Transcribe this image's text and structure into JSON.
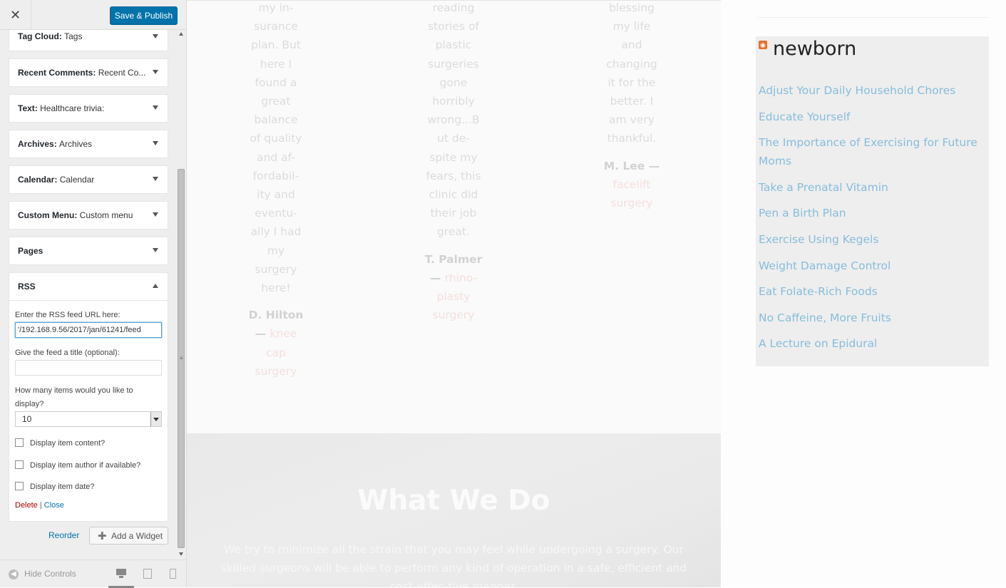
{
  "header": {
    "close_glyph": "✕",
    "save_publish": "Save & Publish"
  },
  "widgets": [
    {
      "type": "Tag Cloud:",
      "name": "Tags"
    },
    {
      "type": "Recent Comments:",
      "name": "Recent Co..."
    },
    {
      "type": "Text:",
      "name": "Healthcare trivia:"
    },
    {
      "type": "Archives:",
      "name": "Archives"
    },
    {
      "type": "Calendar:",
      "name": "Calendar"
    },
    {
      "type": "Custom Menu:",
      "name": "Custom menu"
    },
    {
      "type": "Pages",
      "name": ""
    }
  ],
  "rss_widget": {
    "title": "RSS",
    "url_label": "Enter the RSS feed URL here:",
    "url_value": "'/192.168.9.56/2017/jan/61241/feed",
    "title_label": "Give the feed a title (optional):",
    "title_value": "",
    "count_label": "How many items would you like to display?",
    "count_value": "10",
    "checkboxes": [
      {
        "label": "Display item content?",
        "checked": false
      },
      {
        "label": "Display item author if available?",
        "checked": false
      },
      {
        "label": "Display item date?",
        "checked": false
      }
    ],
    "delete": "Delete",
    "separator": "|",
    "close": "Close"
  },
  "footer": {
    "reorder": "Reorder",
    "add_widget": "Add a Widget",
    "hide_controls": "Hide Controls"
  },
  "preview": {
    "testimonials": [
      {
        "quote": "my in-\nsurance\nplan. But\nhere I\nfound a\ngreat\nbalance\nof quality\nand af-\nfordabil-\nity and\neventu-\nally I had\nmy\nsurgery\nhere!",
        "author": "D. Hilton\n— ",
        "procedure": "knee\ncap\nsurgery"
      },
      {
        "quote": "reading\nstories of\nplastic\nsurgeries\ngone\nhorribly\nwrong...B\nut de-\nspite my\nfears, this\nclinic did\ntheir job\ngreat.",
        "author": "T. Palmer\n— ",
        "procedure": "rhino-\nplasty\nsurgery"
      },
      {
        "quote": "blessing\nmy life\nand\nchanging\nit for the\nbetter. I\nam very\nthankful.",
        "author": "M. Lee —\n",
        "procedure": "facelift\nsurgery"
      }
    ],
    "what_we_do": {
      "title": "What We Do",
      "text": "We try to minimize all the strain that you may feel while undergoing a surgery. Our skilled surgeons will be able to perform any kind of operation in a safe, efficient and cost-effec-tive manner."
    },
    "rss_box": {
      "title": "newborn",
      "items": [
        "Adjust Your Daily Household Chores",
        "Educate Yourself",
        "The Importance of Exercising for Future Moms",
        "Take a Prenatal Vitamin",
        "Pen a Birth Plan",
        "Exercise Using Kegels",
        "Weight Damage Control",
        "Eat Folate-Rich Foods",
        "No Caffeine, More Fruits",
        "A Lecture on Epidural"
      ]
    }
  },
  "colors": {
    "accent": "#0073aa",
    "link": "#87bddb",
    "delete": "#aa0000"
  }
}
